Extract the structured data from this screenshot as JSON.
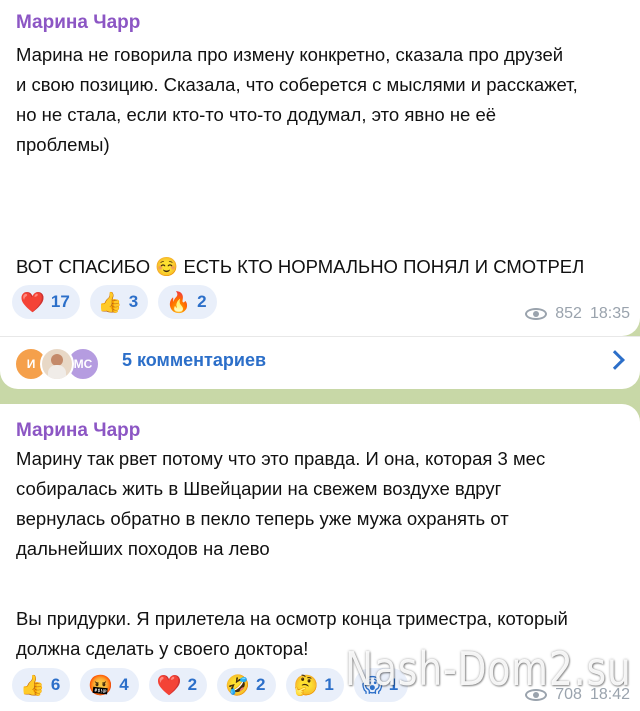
{
  "post1": {
    "author": "Марина Чарр",
    "lines": [
      "Марина не говорила про измену конкретно, сказала про друзей",
      "и свою позицию. Сказала, что соберется с мыслями и расскажет,",
      "но не стала, если кто-то что-то додумал, это явно не её",
      "проблемы)"
    ],
    "line2": "ВОТ СПАСИБО ☺️ ЕСТЬ КТО НОРМАЛЬНО ПОНЯЛ И СМОТРЕЛ",
    "reactions": [
      {
        "emoji": "❤️",
        "count": "17"
      },
      {
        "emoji": "👍",
        "count": "3"
      },
      {
        "emoji": "🔥",
        "count": "2"
      }
    ],
    "views": "852",
    "time": "18:35"
  },
  "comments": {
    "avatar1": "И",
    "avatar3": "МС",
    "label": "5 комментариев"
  },
  "post2": {
    "author": "Марина Чарр",
    "lines": [
      "Марину так рвет потому что это правда. И она, которая 3 мес",
      "собиралась жить в Швейцарии на свежем воздухе вдруг",
      "вернулась обратно в пекло теперь уже мужа охранять от",
      "дальнейших походов на лево"
    ],
    "lines2": [
      "Вы придурки. Я прилетела на осмотр конца триместра, который",
      "должна сделать у своего доктора!"
    ],
    "reactions": [
      {
        "emoji": "👍",
        "count": "6"
      },
      {
        "emoji": "🤬",
        "count": "4"
      },
      {
        "emoji": "❤️",
        "count": "2"
      },
      {
        "emoji": "🤣",
        "count": "2"
      },
      {
        "emoji": "🤔",
        "count": "1"
      },
      {
        "emoji": "😱",
        "count": "1"
      }
    ],
    "views": "708",
    "time": "18:42"
  },
  "watermark": "Nash-Dom2.su"
}
